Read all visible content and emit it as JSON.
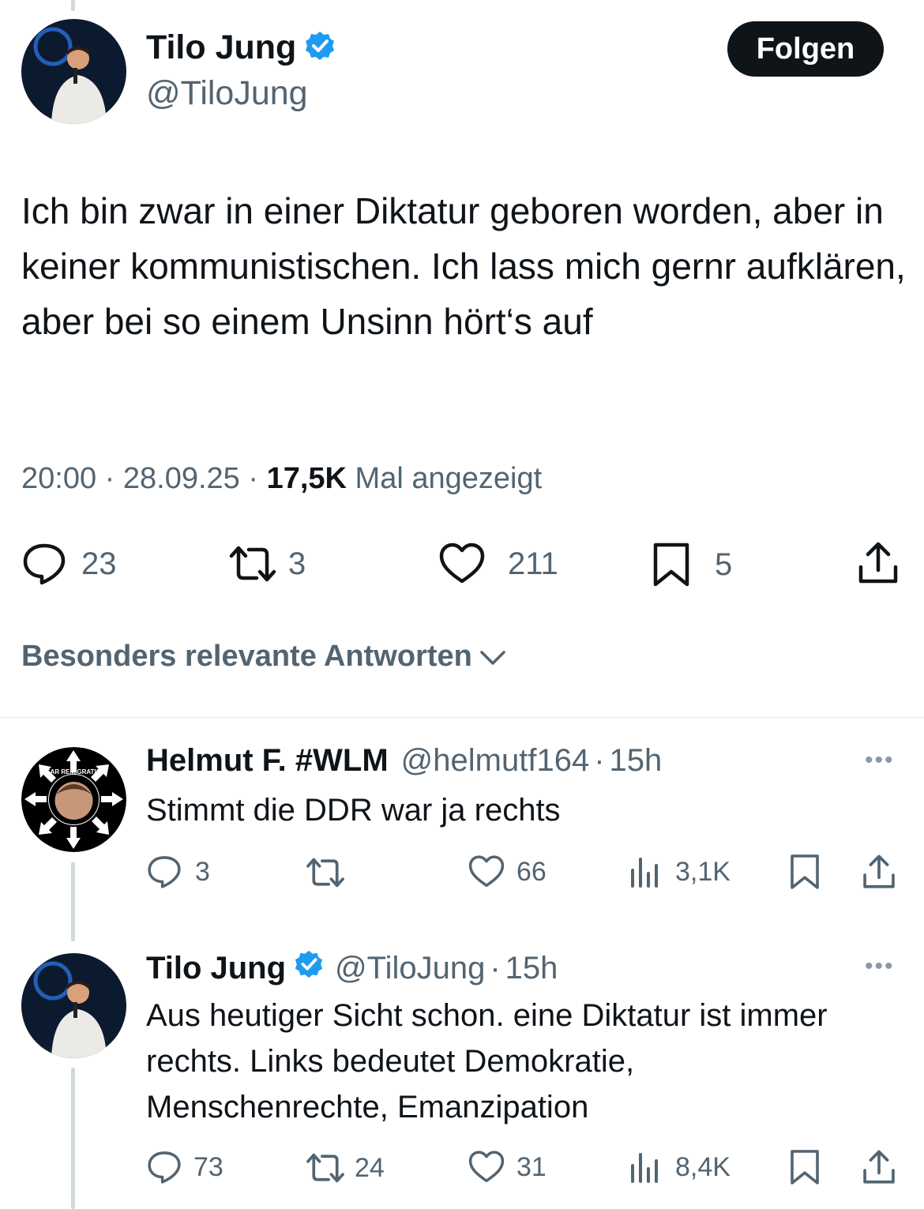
{
  "main_tweet": {
    "author_name": "Tilo Jung",
    "handle": "@TiloJung",
    "follow_label": "Folgen",
    "text": "Ich bin zwar in einer Diktatur geboren worden, aber in keiner kommunistischen. Ich lass mich gernr aufklären, aber bei so einem Unsinn hört‘s auf",
    "time": "20:00",
    "date": "28.09.25",
    "views": "17,5K",
    "views_label": "Mal angezeigt",
    "separator": "·",
    "actions": {
      "replies": "23",
      "reposts": "3",
      "likes": "211",
      "bookmarks": "5"
    }
  },
  "sort": {
    "label": "Besonders relevante Antworten"
  },
  "replies": [
    {
      "author_name": "Helmut F. #WLM",
      "handle": "@helmutf164",
      "age": "15h",
      "text": "Stimmt die DDR war ja rechts",
      "avatar_text": "FEAR REMIGRATION",
      "actions": {
        "replies": "3",
        "reposts": "",
        "likes": "66",
        "views": "3,1K"
      }
    },
    {
      "author_name": "Tilo Jung",
      "handle": "@TiloJung",
      "age": "15h",
      "text": "Aus heutiger Sicht schon. eine Diktatur ist immer rechts. Links bedeutet Demokratie, Menschenrechte, Emanzipation",
      "actions": {
        "replies": "73",
        "reposts": "24",
        "likes": "31",
        "views": "8,4K"
      }
    }
  ],
  "colors": {
    "text": "#0f1419",
    "muted": "#536471",
    "verified": "#1d9bf0",
    "button": "#0f1419"
  },
  "icons": [
    "reply-icon",
    "repost-icon",
    "like-icon",
    "bookmark-icon",
    "share-icon",
    "views-icon",
    "verified-icon",
    "chevron-down-icon",
    "more-icon"
  ]
}
